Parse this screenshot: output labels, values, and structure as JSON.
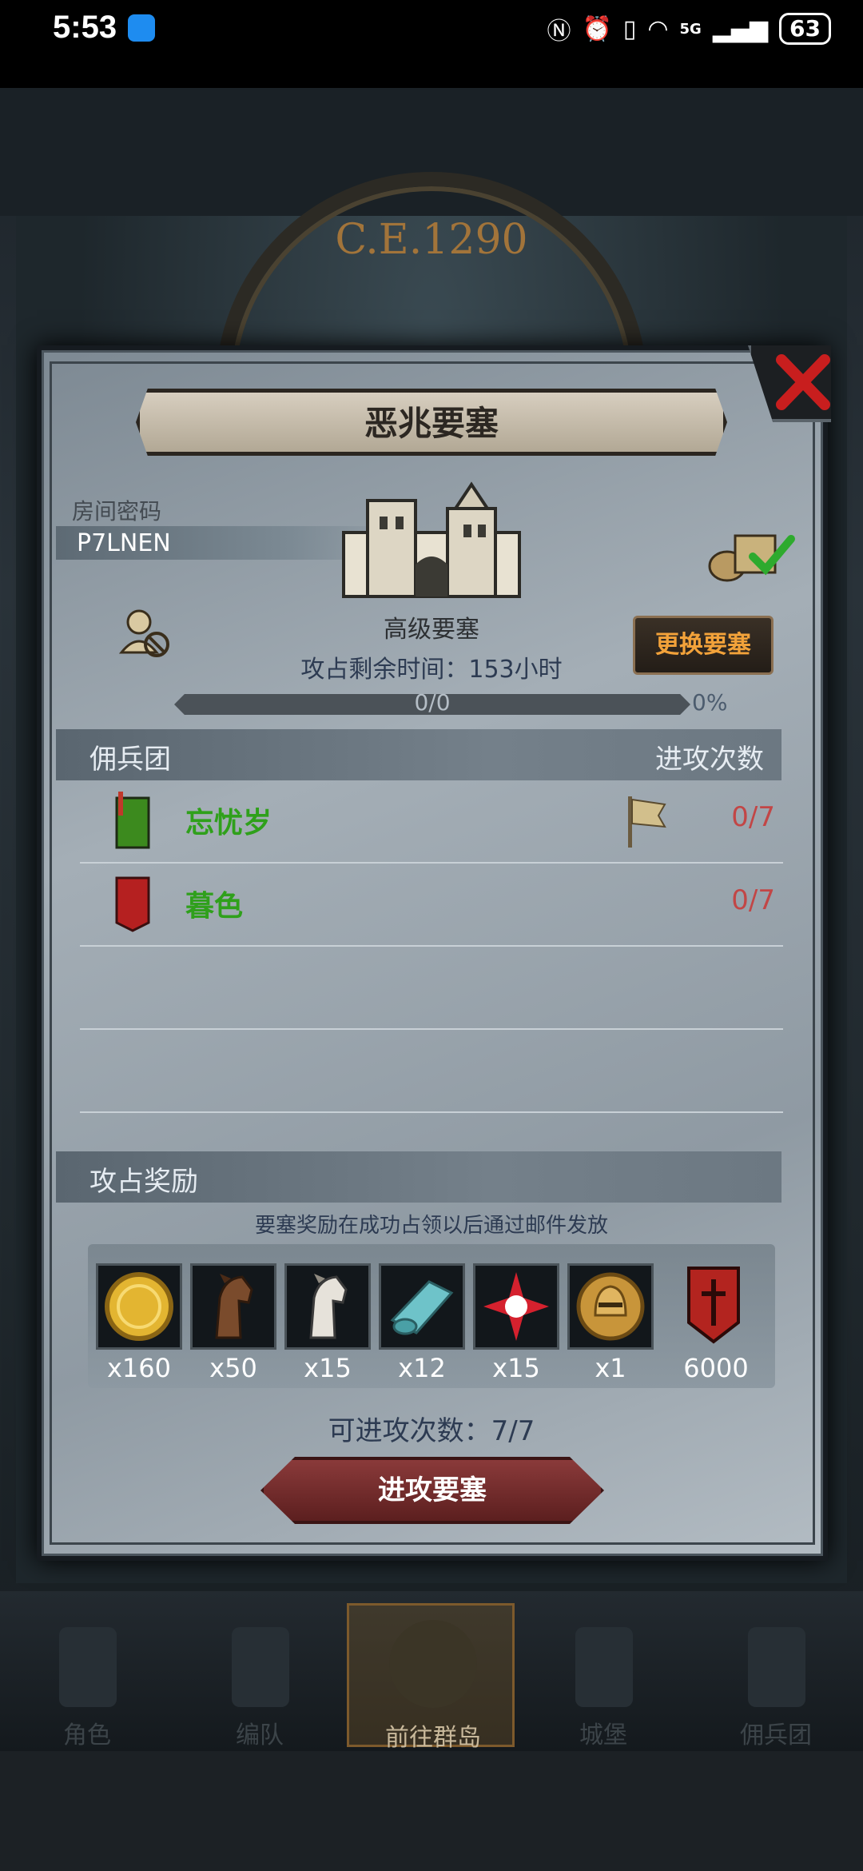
{
  "status_bar": {
    "time": "5:53",
    "network": "5G",
    "battery": "63"
  },
  "background": {
    "era_label": "C.E.1290"
  },
  "dialog": {
    "title": "恶兆要塞",
    "room": {
      "label": "房间密码",
      "code": "P7LNEN"
    },
    "fortress_level": "高级要塞",
    "change_button": "更换要塞",
    "remaining_time": "攻占剩余时间：153小时",
    "progress": {
      "text": "0/0",
      "percent_label": "0%",
      "value": 0
    },
    "mercenary_section": {
      "title": "佣兵团",
      "attacks_header": "进攻次数",
      "rows": [
        {
          "name": "忘忧岁",
          "attacks": "0/7",
          "banner_color": "#3c8a1e"
        },
        {
          "name": "暮色",
          "attacks": "0/7",
          "banner_color": "#b52020"
        }
      ]
    },
    "rewards": {
      "title": "攻占奖励",
      "note": "要塞奖励在成功占领以后通过邮件发放",
      "items": [
        {
          "icon": "gold-coin-icon",
          "count": "x160"
        },
        {
          "icon": "brown-horse-icon",
          "count": "x50"
        },
        {
          "icon": "white-horse-icon",
          "count": "x15"
        },
        {
          "icon": "cloth-roll-icon",
          "count": "x12"
        },
        {
          "icon": "red-star-icon",
          "count": "x15"
        },
        {
          "icon": "helmet-medal-icon",
          "count": "x1"
        },
        {
          "icon": "guild-banner-icon",
          "count": "6000"
        }
      ]
    },
    "attack_count": "可进攻次数：7/7",
    "attack_button": "进攻要塞"
  },
  "bottom_nav": {
    "items": [
      {
        "label": "角色"
      },
      {
        "label": "编队"
      },
      {
        "label": "前往群岛"
      },
      {
        "label": "城堡"
      },
      {
        "label": "佣兵团"
      }
    ],
    "active_index": 2
  }
}
